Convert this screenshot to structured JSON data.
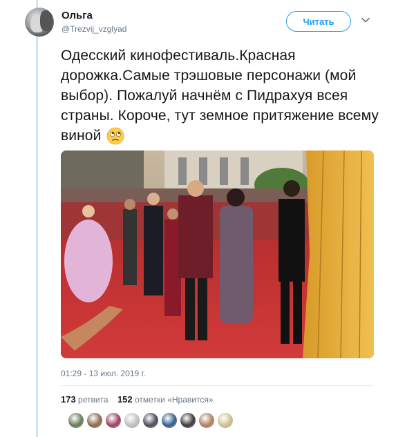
{
  "user": {
    "name": "Ольга",
    "handle": "@Trezvij_vzglyad"
  },
  "follow_button": "Читать",
  "tweet": {
    "text": "Одесский кинофестиваль.Красная дорожка.Самые трэшовые персонажи (мой выбор). Пожалуй начнём с Пидрахуя всея страны. Короче, тут земное притяжение всему виной",
    "emoji": "face-with-rolling-eyes",
    "timestamp": "01:29 - 13 июл. 2019 г."
  },
  "stats": {
    "retweets_count": "173",
    "retweets_label": "ретвита",
    "likes_count": "152",
    "likes_label": "отметки «Нравится»"
  },
  "liker_colors": [
    "#6b7a5a",
    "#8a6a4a",
    "#a04060",
    "#c0c0c0",
    "#4a4a5a",
    "#2f5f8f",
    "#3a3a3a",
    "#b08060",
    "#d0c090"
  ],
  "colors": {
    "accent": "#1da1f2",
    "secondary_text": "#657786",
    "primary_text": "#14171a"
  }
}
